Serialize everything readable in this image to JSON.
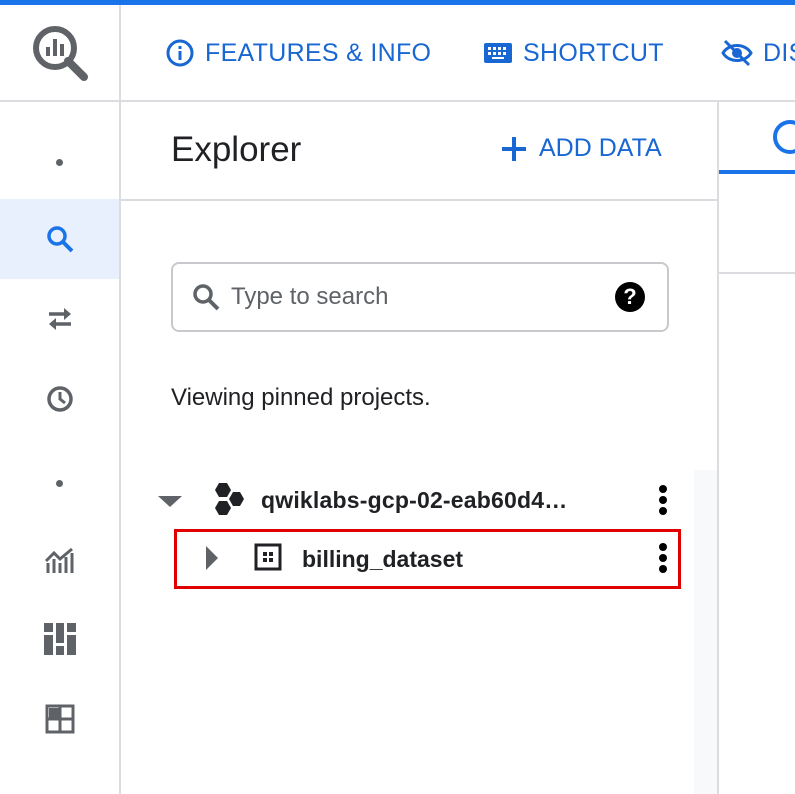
{
  "header": {
    "features_label": "FEATURES & INFO",
    "shortcut_label": "SHORTCUT",
    "disable_label": "DIS"
  },
  "explorer": {
    "title": "Explorer",
    "add_data_label": "ADD DATA",
    "search": {
      "placeholder": "Type to search",
      "value": ""
    },
    "help_label": "?",
    "viewing_text": "Viewing pinned projects.",
    "project": {
      "name": "qwiklabs-gcp-02-eab60d4…"
    },
    "dataset": {
      "name": "billing_dataset"
    }
  },
  "icons": {
    "logo": "bigquery-logo-icon",
    "features": "info-icon",
    "shortcut": "keyboard-icon",
    "disable": "eye-off-icon",
    "add": "plus-icon",
    "rail": [
      "dot-icon",
      "search-icon",
      "transfer-icon",
      "history-icon",
      "dot-icon",
      "analytics-icon",
      "dashboard-icon",
      "table-grid-icon"
    ]
  },
  "colors": {
    "accent": "#1a73e8",
    "link": "#1967d2",
    "highlight": "#e00000",
    "rail_active": "#e8f0fe"
  }
}
